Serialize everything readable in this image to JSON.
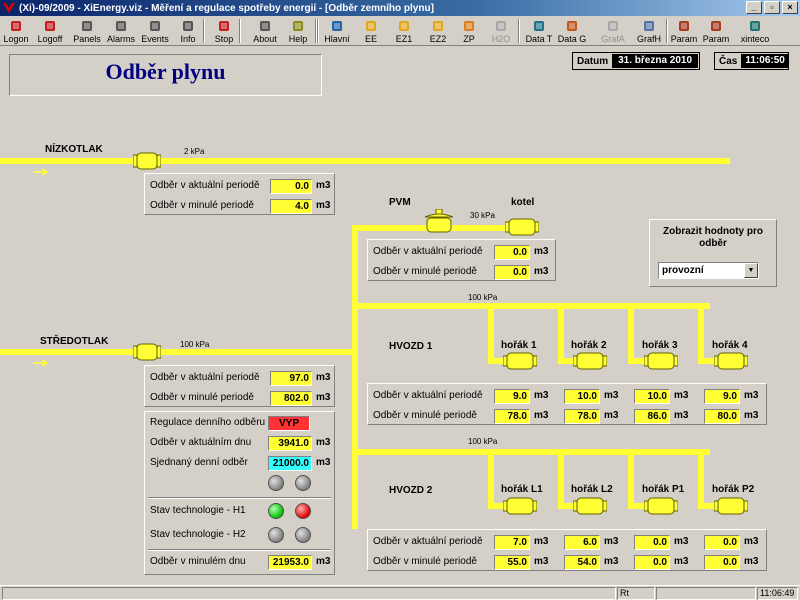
{
  "window": {
    "title": "(Xi)-09/2009 - XiEnergy.viz - Měření a regulace spotřeby energií - [Odběr zemního plynu]",
    "min": "_",
    "max": "▫",
    "close": "×"
  },
  "toolbar": [
    {
      "label": "Logon",
      "icon": "logon-icon"
    },
    {
      "label": "Logoff",
      "icon": "logoff-icon"
    },
    {
      "label": "Panels",
      "icon": "panels-icon"
    },
    {
      "label": "Alarms",
      "icon": "alarms-icon"
    },
    {
      "label": "Events",
      "icon": "events-icon"
    },
    {
      "label": "Info",
      "icon": "info-icon"
    },
    {
      "label": "Stop",
      "icon": "stop-icon"
    },
    {
      "label": "About",
      "icon": "about-icon"
    },
    {
      "label": "Help",
      "icon": "help-icon"
    },
    {
      "label": "Hlavní",
      "icon": "home-icon"
    },
    {
      "label": "EE",
      "icon": "lightning-icon"
    },
    {
      "label": "EZ1",
      "icon": "lightning-icon"
    },
    {
      "label": "EZ2",
      "icon": "lightning-icon"
    },
    {
      "label": "ZP",
      "icon": "gas-flame-icon"
    },
    {
      "label": "H2O",
      "icon": "water-icon",
      "disabled": true
    },
    {
      "label": "Data T",
      "icon": "data-table-icon"
    },
    {
      "label": "Data G",
      "icon": "data-graph-icon"
    },
    {
      "label": "GrafA",
      "icon": "graph-icon",
      "disabled": true
    },
    {
      "label": "GrafH",
      "icon": "graph-icon"
    },
    {
      "label": "Param",
      "icon": "tools-icon"
    },
    {
      "label": "Param",
      "icon": "tools-icon"
    },
    {
      "label": "xinteco",
      "icon": "xinteco-logo-icon"
    }
  ],
  "page": {
    "title": "Odběr plynu",
    "datum_label": "Datum",
    "datum_value": "31. března 2010",
    "cas_label": "Čas",
    "cas_value": "11:06:50"
  },
  "nizkotlak": {
    "label": "NÍZKOTLAK",
    "pressure": "2 kPa",
    "rows": [
      {
        "label": "Odběr v aktuální periodě",
        "value": "0.0",
        "unit": "m3"
      },
      {
        "label": "Odběr v minulé periodě",
        "value": "4.0",
        "unit": "m3"
      }
    ]
  },
  "pvm": {
    "label": "PVM",
    "kotel_label": "kotel",
    "pressure": "30 kPa",
    "rows": [
      {
        "label": "Odběr v aktuální periodě",
        "value": "0.0",
        "unit": "m3"
      },
      {
        "label": "Odběr v minulé periodě",
        "value": "0.0",
        "unit": "m3"
      }
    ]
  },
  "stredotlak": {
    "label": "STŘEDOTLAK",
    "pressure": "100 kPa",
    "rows": [
      {
        "label": "Odběr v aktuální periodě",
        "value": "97.0",
        "unit": "m3"
      },
      {
        "label": "Odběr v minulé periodě",
        "value": "802.0",
        "unit": "m3"
      }
    ]
  },
  "regulace": {
    "reg_label": "Regulace denního odběru",
    "reg_state": "VYP",
    "den_label": "Odběr v aktuálním dnu",
    "den_value": "3941.0",
    "sjed_label": "Sjednaný denní odběr",
    "sjed_value": "21000.0",
    "h1_label": "Stav technologie - H1",
    "h2_label": "Stav technologie - H2",
    "min_label": "Odběr v minulém dnu",
    "min_value": "21953.0",
    "unit": "m3"
  },
  "hvozd1": {
    "label": "HVOZD 1",
    "pressure": "100 kPa",
    "row_labels": [
      "Odběr v aktuální periodě",
      "Odběr v minulé periodě"
    ],
    "burners": [
      {
        "name": "hořák 1",
        "akt": "9.0",
        "min": "78.0"
      },
      {
        "name": "hořák 2",
        "akt": "10.0",
        "min": "78.0"
      },
      {
        "name": "hořák 3",
        "akt": "10.0",
        "min": "86.0"
      },
      {
        "name": "hořák 4",
        "akt": "9.0",
        "min": "80.0"
      }
    ],
    "unit": "m3"
  },
  "hvozd2": {
    "label": "HVOZD 2",
    "pressure": "100 kPa",
    "row_labels": [
      "Odběr v aktuální periodě",
      "Odběr v minulé periodě"
    ],
    "burners": [
      {
        "name": "hořák L1",
        "akt": "7.0",
        "min": "55.0"
      },
      {
        "name": "hořák L2",
        "akt": "6.0",
        "min": "54.0"
      },
      {
        "name": "hořák P1",
        "akt": "0.0",
        "min": "0.0"
      },
      {
        "name": "hořák P2",
        "akt": "0.0",
        "min": "0.0"
      }
    ],
    "unit": "m3"
  },
  "display_select": {
    "caption": "Zobrazit hodnoty pro odběr",
    "value": "provozní"
  },
  "statusbar": {
    "mode": "Rt",
    "time": "11:06:49"
  },
  "colors": {
    "pipe": "#ffff33",
    "value_bg": "#ffff33",
    "alarm_red": "#ff3333",
    "setpoint_cyan": "#33ffff",
    "title_blue": "#000080"
  }
}
